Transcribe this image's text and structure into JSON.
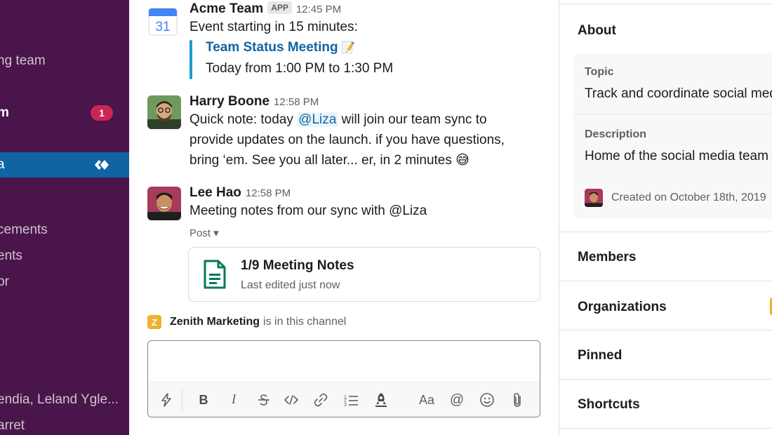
{
  "sidebar": {
    "items": [
      {
        "label": "ng team",
        "style": "normal"
      },
      {
        "label": "m",
        "style": "bold",
        "badge": "1"
      },
      {
        "label": "a",
        "style": "active"
      },
      {
        "label": "cements",
        "style": "normal"
      },
      {
        "label": "ents",
        "style": "normal"
      },
      {
        "label": "pr",
        "style": "normal"
      },
      {
        "label": "endia, Leland Ygle...",
        "style": "normal"
      },
      {
        "label": "arret",
        "style": "normal"
      }
    ]
  },
  "messages": [
    {
      "sender": "Acme Team",
      "app_tag": "APP",
      "time": "12:45 PM",
      "avatar_icon": "calendar-31-icon",
      "calendar_day": "31",
      "text": "Event starting in 15 minutes:",
      "event_title": "Team Status Meeting",
      "event_emoji": "📝",
      "event_time": "Today from 1:00 PM to 1:30 PM"
    },
    {
      "sender": "Harry Boone",
      "time": "12:58 PM",
      "text_before": "Quick note: today ",
      "mention": "@Liza",
      "text_after": " will join our team sync to provide updates on the launch. if you have questions, bring ‘em. See you all later... er, in 2 minutes ",
      "emoji": "😅"
    },
    {
      "sender": "Lee Hao",
      "time": "12:58 PM",
      "text": "Meeting notes from our sync with @Liza",
      "post_label": "Post ▾",
      "file_title": "1/9 Meeting Notes",
      "file_subtitle": "Last edited just now"
    }
  ],
  "channel_note": {
    "badge": "Z",
    "name": "Zenith Marketing",
    "suffix": "is in this channel"
  },
  "composer": {
    "placeholder": "",
    "toolbar": [
      "lightning-icon",
      "bold-icon",
      "italic-icon",
      "strikethrough-icon",
      "code-icon",
      "link-icon",
      "numbered-list-icon",
      "rocket-icon",
      "text-format-icon",
      "at-mention-icon",
      "emoji-icon",
      "attachment-icon"
    ],
    "bold_label": "B",
    "italic_label": "I",
    "format_label": "Aa",
    "at_label": "@"
  },
  "details_panel": {
    "about_heading": "About",
    "topic_label": "Topic",
    "topic_value": "Track and coordinate social med",
    "description_label": "Description",
    "description_value": "Home of the social media team",
    "created_text": "Created on October 18th, 2019",
    "sections": [
      "Members",
      "Organizations",
      "Pinned",
      "Shortcuts"
    ]
  },
  "colors": {
    "sidebar_bg": "#4a154b",
    "active_item": "#1164a3",
    "badge": "#cd2553",
    "link": "#1264a3",
    "quote_bar": "#1d9bd1",
    "file_icon": "#007a5a",
    "zenith": "#ecb22e"
  }
}
